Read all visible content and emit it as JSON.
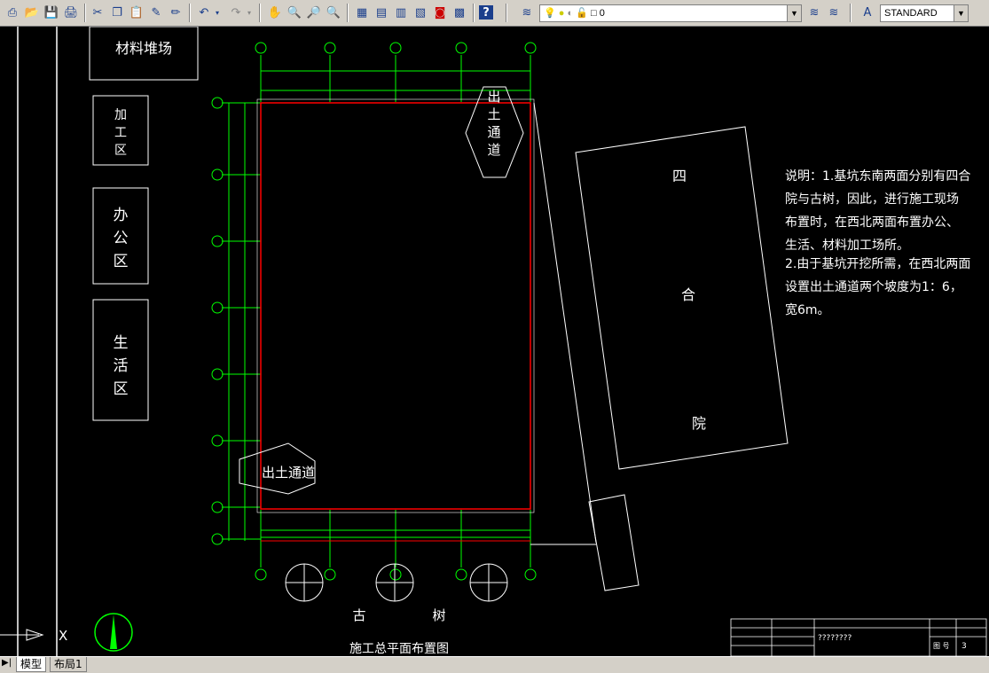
{
  "toolbar": {
    "layer_value": "0",
    "text_style": "STANDARD"
  },
  "zones": {
    "material_yard": "材料堆场",
    "processing_area": [
      "加",
      "工",
      "区"
    ],
    "office_area": [
      "办",
      "公",
      "区"
    ],
    "living_area": [
      "生",
      "活",
      "区"
    ]
  },
  "courtyard": {
    "chars": [
      "四",
      "合",
      "院"
    ]
  },
  "exit_passage_top": [
    "出",
    "土",
    "通",
    "道"
  ],
  "exit_passage_left": "出土通道",
  "notes": {
    "lines": [
      "说明：1.基坑东南两面分别有四合",
      "院与古树，因此，进行施工现场",
      "布置时，在西北两面布置办公、",
      "生活、材料加工场所。",
      "2.由于基坑开挖所需，在西北两面",
      "设置出土通道两个坡度为1：6，",
      "宽6m。"
    ]
  },
  "trees_label": [
    "古",
    "树"
  ],
  "drawing_title": "施工总平面布置图",
  "title_block": {
    "drawing_name": "????????",
    "sheet_label": "图 号",
    "sheet_no": "3"
  },
  "status": {
    "tabs": [
      "模型",
      "布局1"
    ]
  },
  "colors": {
    "pit_outline": "#ff0000",
    "dimension_lines": "#00ff00",
    "background": "#000000",
    "linework": "#ffffff"
  }
}
